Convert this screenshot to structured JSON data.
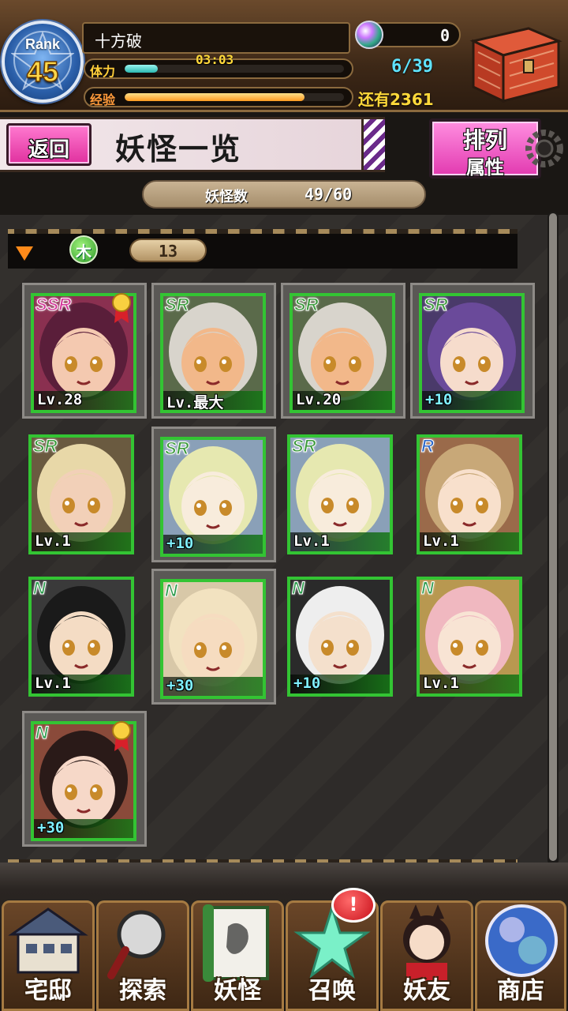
{
  "player": {
    "rank_label": "Rank",
    "rank": "45",
    "name": "十方破",
    "stamina_label": "体力",
    "stamina_timer": "03:03",
    "stamina_count": "6/39",
    "stamina_fill": 0.15,
    "exp_label": "经验",
    "exp_remaining": "还有2361",
    "exp_fill": 0.82,
    "orbs": "0"
  },
  "header": {
    "back_label": "返回",
    "title": "妖怪一览",
    "sort_line1": "排列",
    "sort_line2": "属性"
  },
  "count": {
    "label": "妖怪数",
    "value": "49/60"
  },
  "group": {
    "element_icon": "木",
    "count": "13"
  },
  "cards": [
    {
      "rarity": "SSR",
      "level": "Lv.28",
      "medal": true,
      "selected": true,
      "hair": "#5a1e3a",
      "skin": "#f4c9b0",
      "bg": "#8a3050"
    },
    {
      "rarity": "SR",
      "level": "Lv.最大",
      "medal": false,
      "selected": true,
      "hair": "#d8d4cc",
      "skin": "#f2b88a",
      "bg": "#5a6a4a"
    },
    {
      "rarity": "SR",
      "level": "Lv.20",
      "medal": false,
      "selected": true,
      "hair": "#d8d4cc",
      "skin": "#f2b88a",
      "bg": "#5a6a4a"
    },
    {
      "rarity": "SR",
      "level": "+10",
      "medal": false,
      "selected": true,
      "hair": "#6a4a9a",
      "skin": "#f6dccc",
      "bg": "#4a3a6a"
    },
    {
      "rarity": "SR",
      "level": "Lv.1",
      "medal": false,
      "selected": false,
      "hair": "#e8d8a8",
      "skin": "#f2d0b8",
      "bg": "#6a5a40"
    },
    {
      "rarity": "SR",
      "level": "+10",
      "medal": false,
      "selected": true,
      "hair": "#e6e8b0",
      "skin": "#f8ecdc",
      "bg": "#8aa0b8"
    },
    {
      "rarity": "SR",
      "level": "Lv.1",
      "medal": false,
      "selected": false,
      "hair": "#e6e8b0",
      "skin": "#f8ecdc",
      "bg": "#8aa0b8"
    },
    {
      "rarity": "R",
      "level": "Lv.1",
      "medal": false,
      "selected": false,
      "hair": "#c8a878",
      "skin": "#f8e0cc",
      "bg": "#9a6a4a"
    },
    {
      "rarity": "N",
      "level": "Lv.1",
      "medal": false,
      "selected": false,
      "hair": "#1a1a1a",
      "skin": "#f4dcc4",
      "bg": "#3a3a3a"
    },
    {
      "rarity": "N",
      "level": "+30",
      "medal": false,
      "selected": true,
      "hair": "#f2e2c0",
      "skin": "#f6dcc0",
      "bg": "#d8c8a8"
    },
    {
      "rarity": "N",
      "level": "+10",
      "medal": false,
      "selected": false,
      "hair": "#eeeeee",
      "skin": "#f4e0cc",
      "bg": "#2a2a2a"
    },
    {
      "rarity": "N",
      "level": "Lv.1",
      "medal": false,
      "selected": false,
      "hair": "#f0b8c0",
      "skin": "#f8e4d4",
      "bg": "#b89850"
    },
    {
      "rarity": "N",
      "level": "+30",
      "medal": true,
      "selected": true,
      "hair": "#2a1a18",
      "skin": "#f6d8c8",
      "bg": "#8a4a3a"
    }
  ],
  "nav": [
    {
      "label": "宅邸",
      "icon": "house-icon"
    },
    {
      "label": "探索",
      "icon": "magnifier-icon"
    },
    {
      "label": "妖怪",
      "icon": "scroll-icon"
    },
    {
      "label": "召唤",
      "icon": "pentagram-icon"
    },
    {
      "label": "妖友",
      "icon": "friend-icon"
    },
    {
      "label": "商店",
      "icon": "orb-shop-icon"
    }
  ],
  "notify_badge": "!",
  "colors": {
    "accent_pink": "#e23ab0",
    "frame_green": "#33c433",
    "gold": "#ffd93a"
  }
}
